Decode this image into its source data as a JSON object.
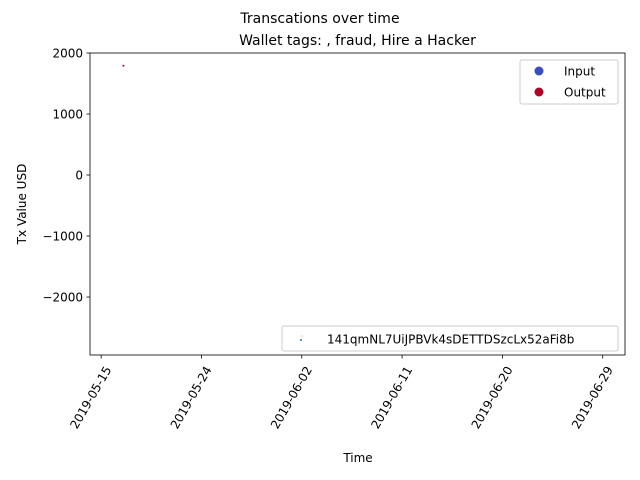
{
  "chart_data": {
    "type": "scatter",
    "suptitle": "Transcations over time",
    "title": "Wallet tags: , fraud, Hire a Hacker",
    "xlabel": "Time",
    "ylabel": "Tx Value USD",
    "xlim": [
      "2019-05-14",
      "2019-07-01"
    ],
    "ylim": [
      -2950,
      2000
    ],
    "x_ticks": [
      "2019-05-15",
      "2019-05-24",
      "2019-06-02",
      "2019-06-11",
      "2019-06-20",
      "2019-06-29"
    ],
    "y_ticks": [
      2000,
      1000,
      0,
      -1000,
      -2000
    ],
    "y_tick_labels": [
      "2000",
      "1000",
      "0",
      "−1000",
      "−2000"
    ],
    "tick_label_rotation": 60,
    "series": [
      {
        "name": "141qmNL7UiJPBVk4sDETTDSzcLx52aFi8b",
        "color": "#1f77b4",
        "marker": "point",
        "points": [
          {
            "x": "2019-06-02",
            "y": -2640
          }
        ]
      },
      {
        "name": "Output",
        "color": "#b40426",
        "marker": "point",
        "points": [
          {
            "x": "2019-05-17",
            "y": 1790
          }
        ]
      }
    ],
    "legends": [
      {
        "placement": "upper-right",
        "entries": [
          {
            "label": "Input",
            "color": "#3b4cc0"
          },
          {
            "label": "Output",
            "color": "#b40426"
          }
        ]
      },
      {
        "placement": "lower-right",
        "entries": [
          {
            "label": "141qmNL7UiJPBVk4sDETTDSzcLx52aFi8b",
            "color": "#1f77b4"
          }
        ]
      }
    ]
  }
}
